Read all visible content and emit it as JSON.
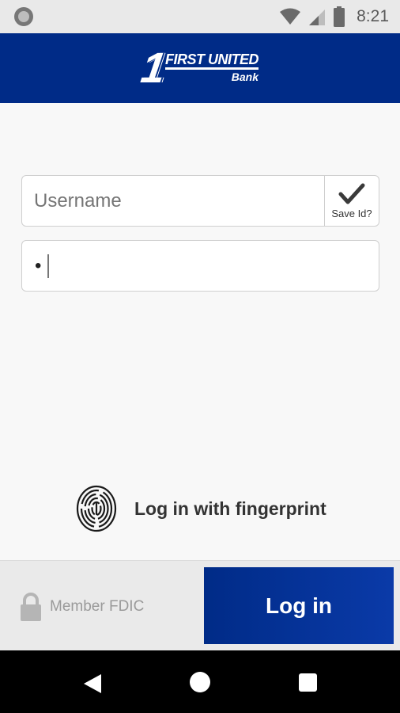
{
  "status_bar": {
    "time": "8:21",
    "icons": [
      "notification-dot-icon",
      "wifi-icon",
      "signal-icon",
      "battery-icon"
    ]
  },
  "header": {
    "logo_numeral": "1",
    "logo_line1": "FIRST UNITED",
    "logo_line2": "Bank",
    "background_color": "#002b87"
  },
  "login_form": {
    "username_placeholder": "Username",
    "save_id_label": "Save Id?",
    "save_id_checked": true,
    "password_value": "•"
  },
  "fingerprint": {
    "label": "Log in with fingerprint",
    "icon": "fingerprint-icon"
  },
  "footer": {
    "fdic_label": "Member FDIC",
    "login_button_label": "Log in",
    "lock_icon": "lock-icon"
  },
  "nav_bar": {
    "icons": [
      "back-icon",
      "home-icon",
      "recents-icon"
    ]
  }
}
